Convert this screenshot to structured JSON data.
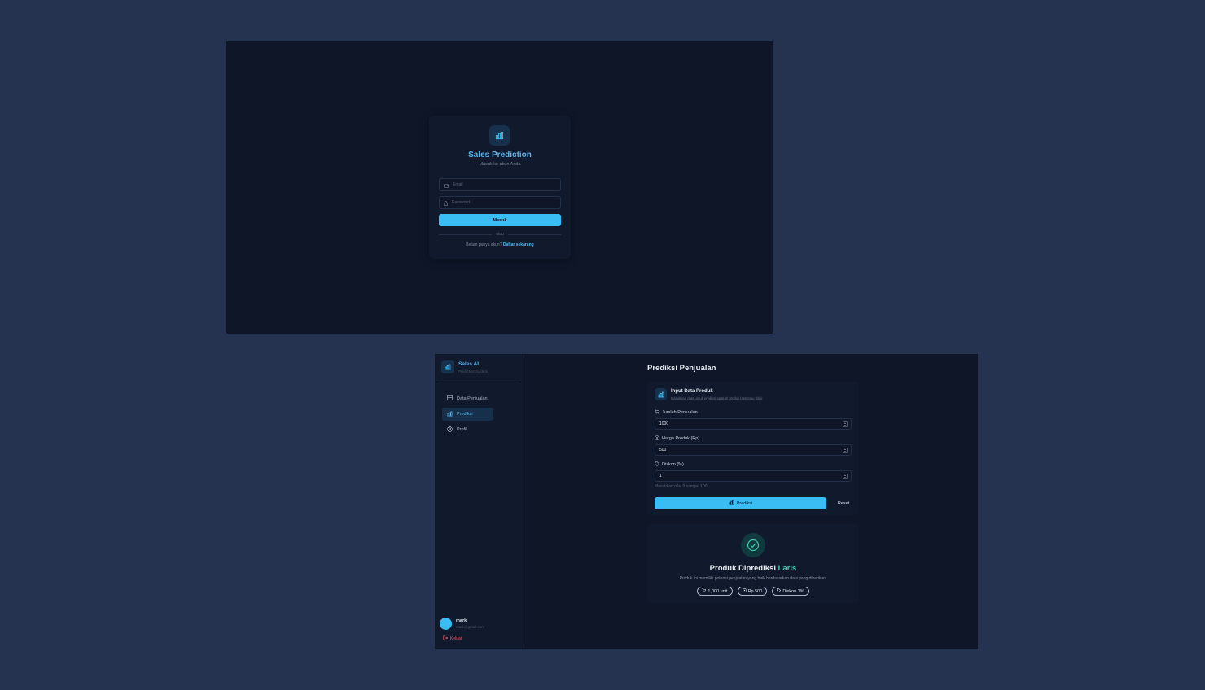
{
  "login": {
    "title": "Sales Prediction",
    "subtitle": "Masuk ke akun Anda",
    "email_placeholder": "Email",
    "password_placeholder": "Password",
    "submit_label": "Masuk",
    "divider_text": "atau",
    "register_prompt": "Belum punya akun?",
    "register_link": "Daftar sekarang",
    "icons": [
      "bar-chart-icon",
      "mail-icon",
      "lock-icon"
    ]
  },
  "app": {
    "brand": {
      "name": "Sales AI",
      "subtitle": "Prediction System"
    },
    "nav": [
      {
        "label": "Data Penjualan",
        "icon": "table-icon",
        "active": false
      },
      {
        "label": "Prediksi",
        "icon": "bar-chart-icon",
        "active": true
      },
      {
        "label": "Profil",
        "icon": "user-circle-icon",
        "active": false
      }
    ],
    "user": {
      "name": "mark",
      "email": "mark@gmail.com"
    },
    "logout_label": "Keluar",
    "page_title": "Prediksi Penjualan",
    "form": {
      "title": "Input Data Produk",
      "description": "Masukkan data untuk prediksi apakah produk laris atau tidak",
      "fields": [
        {
          "label": "Jumlah Penjualan",
          "value": "1000",
          "icon": "cart-icon"
        },
        {
          "label": "Harga Produk (Rp)",
          "value": "500",
          "icon": "coin-icon"
        },
        {
          "label": "Diskon (%)",
          "value": "1",
          "icon": "tag-icon"
        }
      ],
      "hint": "Masukkan nilai 0 sampai 100",
      "predict_label": "Prediksi",
      "reset_label": "Reset"
    },
    "result": {
      "title_prefix": "Produk Diprediksi",
      "title_accent": "Laris",
      "description": "Produk ini memiliki potensi penjualan yang baik berdasarkan data yang diberikan.",
      "badges": [
        "1,000 unit",
        "Rp 500",
        "Diskon 1%"
      ]
    }
  },
  "colors": {
    "background": "#253350",
    "screen": "#0e1628",
    "card": "#111a2d",
    "accent": "#39bdf3",
    "success": "#3fc9b0",
    "danger": "#f0505b"
  }
}
